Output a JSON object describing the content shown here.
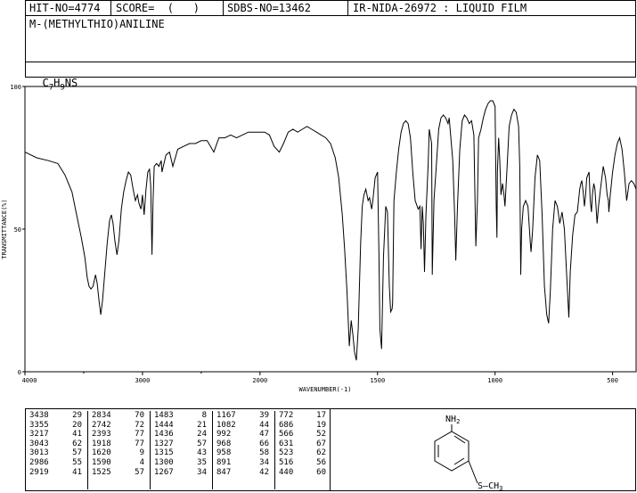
{
  "header": {
    "hit_no": "HIT-NO=4774",
    "score": "SCORE=  (   )",
    "sdbs_no": "SDBS-NO=13462",
    "ir_nida": "IR-NIDA-26972 : LIQUID FILM",
    "compound_name": "M-(METHYLTHIO)ANILINE",
    "formula": "C7H9NS",
    "formula_parts": {
      "c": "C",
      "c_sub": "7",
      "h": "H",
      "h_sub": "9",
      "rest": "NS"
    }
  },
  "structure": {
    "nh2_label": "NH2",
    "nh2_parts": {
      "n": "N",
      "h": "H",
      "sub": "2"
    },
    "sch3_label": "S-CH3",
    "sch3_parts": {
      "s": "S",
      "dash": "–",
      "ch": "CH",
      "sub": "3"
    }
  },
  "chart_data": {
    "type": "line",
    "title": "",
    "xlabel": "WAVENUMBER(-1)",
    "ylabel": "TRANSMITTANCE(%)",
    "xlim": [
      4000,
      400
    ],
    "ylim": [
      0,
      100
    ],
    "x_ticks": [
      "4000",
      "3000",
      "2000",
      "1500",
      "1000",
      "500"
    ],
    "y_ticks": [
      "100",
      "50",
      "0"
    ],
    "x_tick_values": [
      4000,
      3000,
      2000,
      1500,
      1000,
      500
    ],
    "y_tick_values": [
      100,
      50,
      0
    ],
    "x_tick_minor": [
      3500,
      2500
    ],
    "scale_note": "x axis: 4000-2000 half scale, 2000-400 full scale",
    "series": [
      {
        "points": [
          [
            4000,
            77
          ],
          [
            3900,
            75
          ],
          [
            3800,
            74
          ],
          [
            3720,
            73
          ],
          [
            3660,
            69
          ],
          [
            3600,
            63
          ],
          [
            3560,
            55
          ],
          [
            3520,
            47
          ],
          [
            3490,
            40
          ],
          [
            3470,
            33
          ],
          [
            3455,
            30
          ],
          [
            3438,
            29
          ],
          [
            3420,
            30
          ],
          [
            3400,
            34
          ],
          [
            3385,
            31
          ],
          [
            3370,
            25
          ],
          [
            3355,
            20
          ],
          [
            3340,
            25
          ],
          [
            3320,
            35
          ],
          [
            3300,
            45
          ],
          [
            3280,
            53
          ],
          [
            3265,
            55
          ],
          [
            3250,
            52
          ],
          [
            3235,
            46
          ],
          [
            3217,
            41
          ],
          [
            3200,
            46
          ],
          [
            3180,
            57
          ],
          [
            3160,
            63
          ],
          [
            3140,
            67
          ],
          [
            3120,
            70
          ],
          [
            3100,
            69
          ],
          [
            3080,
            64
          ],
          [
            3060,
            60
          ],
          [
            3043,
            62
          ],
          [
            3030,
            59
          ],
          [
            3013,
            57
          ],
          [
            3000,
            62
          ],
          [
            2990,
            57
          ],
          [
            2986,
            55
          ],
          [
            2970,
            64
          ],
          [
            2955,
            70
          ],
          [
            2940,
            71
          ],
          [
            2930,
            65
          ],
          [
            2919,
            41
          ],
          [
            2910,
            60
          ],
          [
            2900,
            72
          ],
          [
            2880,
            73
          ],
          [
            2860,
            72
          ],
          [
            2840,
            74
          ],
          [
            2834,
            70
          ],
          [
            2800,
            76
          ],
          [
            2770,
            77
          ],
          [
            2742,
            72
          ],
          [
            2700,
            78
          ],
          [
            2650,
            79
          ],
          [
            2600,
            80
          ],
          [
            2550,
            80
          ],
          [
            2500,
            81
          ],
          [
            2450,
            81
          ],
          [
            2393,
            77
          ],
          [
            2350,
            82
          ],
          [
            2300,
            82
          ],
          [
            2250,
            83
          ],
          [
            2200,
            82
          ],
          [
            2150,
            83
          ],
          [
            2100,
            84
          ],
          [
            2050,
            84
          ],
          [
            2000,
            84
          ],
          [
            1980,
            84
          ],
          [
            1960,
            83
          ],
          [
            1940,
            79
          ],
          [
            1918,
            77
          ],
          [
            1900,
            80
          ],
          [
            1880,
            84
          ],
          [
            1860,
            85
          ],
          [
            1840,
            84
          ],
          [
            1820,
            85
          ],
          [
            1800,
            86
          ],
          [
            1780,
            85
          ],
          [
            1760,
            84
          ],
          [
            1740,
            83
          ],
          [
            1720,
            82
          ],
          [
            1700,
            80
          ],
          [
            1680,
            75
          ],
          [
            1665,
            68
          ],
          [
            1650,
            55
          ],
          [
            1640,
            43
          ],
          [
            1630,
            28
          ],
          [
            1620,
            9
          ],
          [
            1612,
            18
          ],
          [
            1605,
            13
          ],
          [
            1598,
            7
          ],
          [
            1590,
            4
          ],
          [
            1582,
            15
          ],
          [
            1572,
            45
          ],
          [
            1565,
            58
          ],
          [
            1558,
            62
          ],
          [
            1550,
            64
          ],
          [
            1540,
            60
          ],
          [
            1534,
            61
          ],
          [
            1525,
            57
          ],
          [
            1520,
            60
          ],
          [
            1510,
            68
          ],
          [
            1500,
            70
          ],
          [
            1494,
            40
          ],
          [
            1490,
            15
          ],
          [
            1483,
            8
          ],
          [
            1475,
            40
          ],
          [
            1465,
            58
          ],
          [
            1458,
            56
          ],
          [
            1450,
            30
          ],
          [
            1444,
            21
          ],
          [
            1438,
            22
          ],
          [
            1436,
            24
          ],
          [
            1430,
            60
          ],
          [
            1420,
            70
          ],
          [
            1410,
            78
          ],
          [
            1400,
            84
          ],
          [
            1390,
            87
          ],
          [
            1380,
            88
          ],
          [
            1370,
            87
          ],
          [
            1360,
            82
          ],
          [
            1350,
            70
          ],
          [
            1340,
            60
          ],
          [
            1327,
            57
          ],
          [
            1320,
            58
          ],
          [
            1315,
            43
          ],
          [
            1310,
            58
          ],
          [
            1305,
            52
          ],
          [
            1300,
            35
          ],
          [
            1294,
            55
          ],
          [
            1285,
            72
          ],
          [
            1280,
            85
          ],
          [
            1270,
            80
          ],
          [
            1267,
            34
          ],
          [
            1260,
            60
          ],
          [
            1250,
            72
          ],
          [
            1240,
            85
          ],
          [
            1230,
            89
          ],
          [
            1220,
            90
          ],
          [
            1210,
            89
          ],
          [
            1200,
            87
          ],
          [
            1195,
            89
          ],
          [
            1180,
            74
          ],
          [
            1172,
            55
          ],
          [
            1167,
            39
          ],
          [
            1160,
            58
          ],
          [
            1150,
            78
          ],
          [
            1140,
            88
          ],
          [
            1130,
            90
          ],
          [
            1120,
            89
          ],
          [
            1110,
            87
          ],
          [
            1100,
            88
          ],
          [
            1090,
            83
          ],
          [
            1082,
            44
          ],
          [
            1075,
            60
          ],
          [
            1070,
            82
          ],
          [
            1060,
            85
          ],
          [
            1050,
            89
          ],
          [
            1040,
            92
          ],
          [
            1030,
            94
          ],
          [
            1020,
            95
          ],
          [
            1010,
            95
          ],
          [
            1000,
            93
          ],
          [
            995,
            58
          ],
          [
            992,
            47
          ],
          [
            990,
            70
          ],
          [
            985,
            82
          ],
          [
            980,
            74
          ],
          [
            975,
            62
          ],
          [
            968,
            66
          ],
          [
            962,
            62
          ],
          [
            958,
            58
          ],
          [
            950,
            70
          ],
          [
            940,
            86
          ],
          [
            930,
            90
          ],
          [
            920,
            92
          ],
          [
            910,
            91
          ],
          [
            900,
            86
          ],
          [
            895,
            72
          ],
          [
            891,
            34
          ],
          [
            887,
            50
          ],
          [
            880,
            58
          ],
          [
            870,
            60
          ],
          [
            860,
            58
          ],
          [
            850,
            45
          ],
          [
            847,
            42
          ],
          [
            840,
            50
          ],
          [
            830,
            68
          ],
          [
            820,
            76
          ],
          [
            810,
            74
          ],
          [
            800,
            55
          ],
          [
            790,
            30
          ],
          [
            780,
            20
          ],
          [
            772,
            17
          ],
          [
            765,
            28
          ],
          [
            755,
            50
          ],
          [
            745,
            60
          ],
          [
            735,
            58
          ],
          [
            725,
            52
          ],
          [
            715,
            56
          ],
          [
            705,
            50
          ],
          [
            698,
            38
          ],
          [
            690,
            25
          ],
          [
            686,
            19
          ],
          [
            680,
            35
          ],
          [
            670,
            48
          ],
          [
            660,
            55
          ],
          [
            650,
            56
          ],
          [
            645,
            60
          ],
          [
            640,
            64
          ],
          [
            635,
            66
          ],
          [
            631,
            67
          ],
          [
            625,
            63
          ],
          [
            620,
            58
          ],
          [
            615,
            62
          ],
          [
            610,
            68
          ],
          [
            600,
            70
          ],
          [
            595,
            60
          ],
          [
            590,
            56
          ],
          [
            586,
            62
          ],
          [
            580,
            66
          ],
          [
            575,
            64
          ],
          [
            566,
            52
          ],
          [
            560,
            58
          ],
          [
            550,
            65
          ],
          [
            540,
            72
          ],
          [
            530,
            68
          ],
          [
            523,
            62
          ],
          [
            518,
            60
          ],
          [
            516,
            56
          ],
          [
            510,
            62
          ],
          [
            500,
            70
          ],
          [
            490,
            76
          ],
          [
            480,
            80
          ],
          [
            470,
            82
          ],
          [
            460,
            78
          ],
          [
            450,
            70
          ],
          [
            440,
            60
          ],
          [
            430,
            66
          ],
          [
            420,
            67
          ],
          [
            410,
            66
          ],
          [
            400,
            64
          ]
        ]
      }
    ]
  },
  "peak_table": {
    "columns": [
      [
        [
          "3438",
          "29"
        ],
        [
          "3355",
          "20"
        ],
        [
          "3217",
          "41"
        ],
        [
          "3043",
          "62"
        ],
        [
          "3013",
          "57"
        ],
        [
          "2986",
          "55"
        ],
        [
          "2919",
          "41"
        ]
      ],
      [
        [
          "2834",
          "70"
        ],
        [
          "2742",
          "72"
        ],
        [
          "2393",
          "77"
        ],
        [
          "1918",
          "77"
        ],
        [
          "1620",
          "9"
        ],
        [
          "1590",
          "4"
        ],
        [
          "1525",
          "57"
        ]
      ],
      [
        [
          "1483",
          "8"
        ],
        [
          "1444",
          "21"
        ],
        [
          "1436",
          "24"
        ],
        [
          "1327",
          "57"
        ],
        [
          "1315",
          "43"
        ],
        [
          "1300",
          "35"
        ],
        [
          "1267",
          "34"
        ]
      ],
      [
        [
          "1167",
          "39"
        ],
        [
          "1082",
          "44"
        ],
        [
          "992",
          "47"
        ],
        [
          "968",
          "66"
        ],
        [
          "958",
          "58"
        ],
        [
          "891",
          "34"
        ],
        [
          "847",
          "42"
        ]
      ],
      [
        [
          "772",
          "17"
        ],
        [
          "686",
          "19"
        ],
        [
          "566",
          "52"
        ],
        [
          "631",
          "67"
        ],
        [
          "523",
          "62"
        ],
        [
          "516",
          "56"
        ],
        [
          "440",
          "60"
        ]
      ]
    ]
  }
}
